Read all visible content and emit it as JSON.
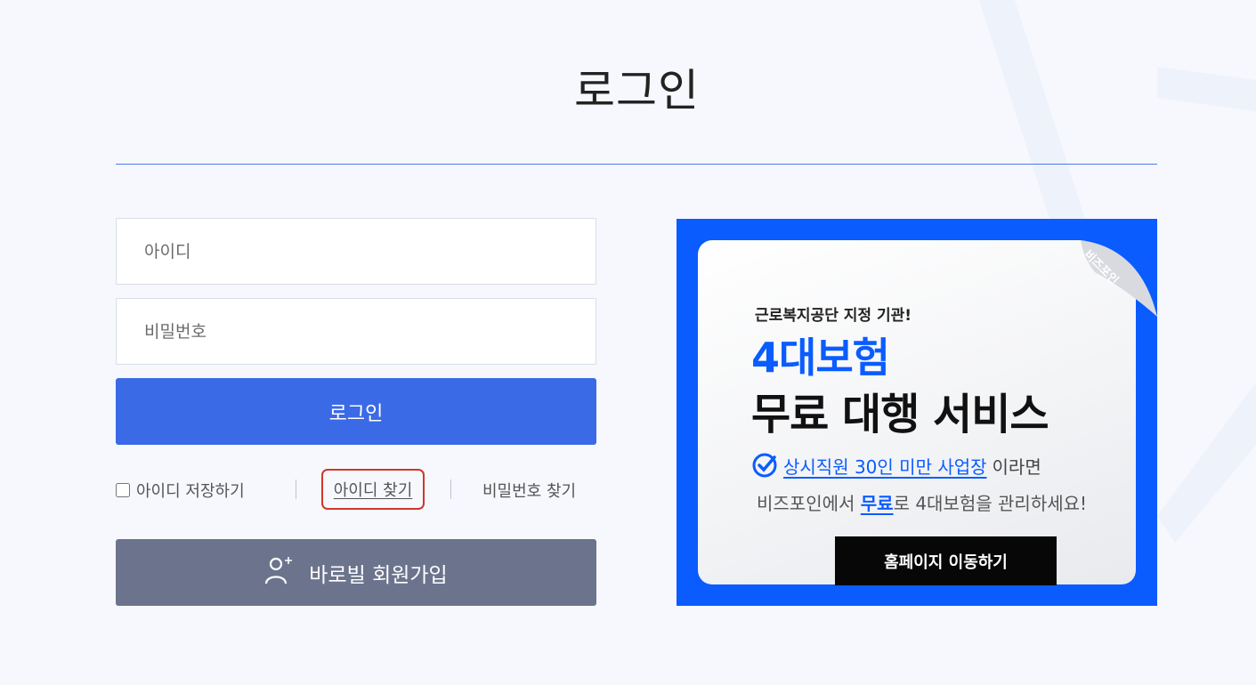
{
  "page": {
    "title": "로그인"
  },
  "login_form": {
    "id_placeholder": "아이디",
    "password_placeholder": "비밀번호",
    "login_button": "로그인",
    "save_id_label": "아이디 저장하기",
    "find_id_label": "아이디 찾기",
    "find_password_label": "비밀번호 찾기",
    "signup_button": "바로빌 회원가입"
  },
  "banner": {
    "brand": "비즈포인",
    "kicker": "근로복지공단 지정 기관!",
    "headline_1": "4대보험",
    "headline_2": "무료 대행 서비스",
    "line3_highlight": "상시직원 30인 미만 사업장",
    "line3_rest": "이라면",
    "line4_pre": "비즈포인에서 ",
    "line4_free": "무료",
    "line4_post": "로 4대보험을 관리하세요!",
    "cta_button": "홈페이지 이동하기"
  },
  "colors": {
    "background": "#f6f8fd",
    "primary": "#3b6ae6",
    "signup": "#6c748d",
    "banner_blue": "#0a5cff",
    "highlight_border": "#d1362b"
  },
  "icons": {
    "signup": "user-plus-icon",
    "banner_check": "check-circle-icon",
    "checkbox": "checkbox-icon"
  }
}
